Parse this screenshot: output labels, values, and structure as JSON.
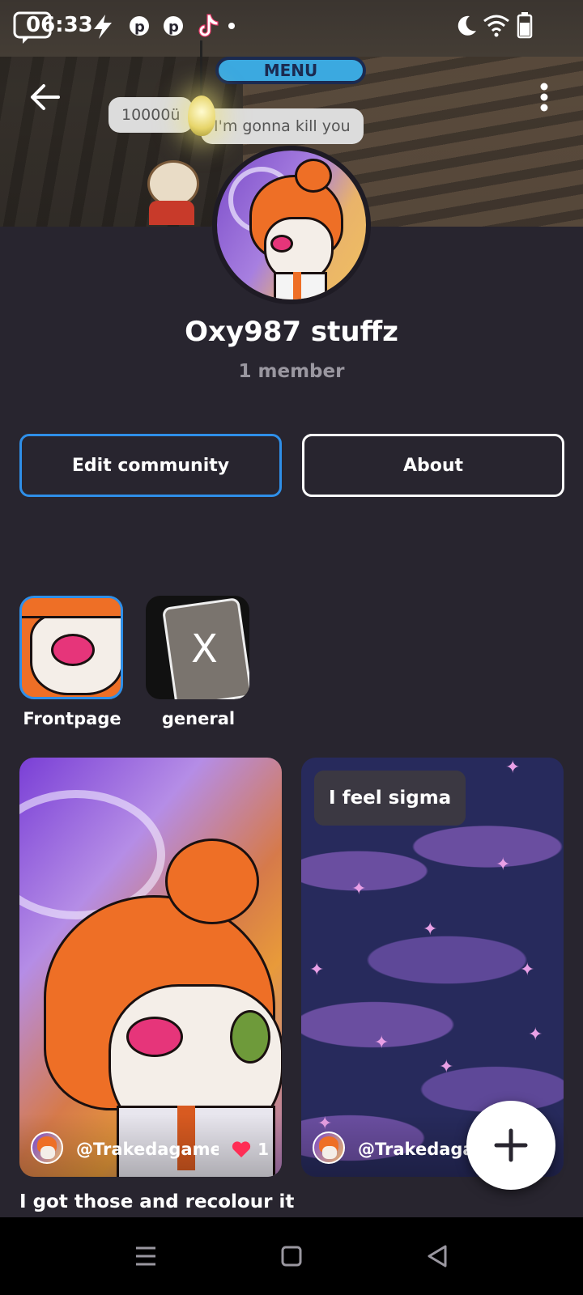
{
  "status_bar": {
    "time": "06:33",
    "icons": [
      "message-icon",
      "bolt-icon",
      "pinterest-icon",
      "pinterest-icon",
      "tiktok-icon",
      "dnd-moon-icon",
      "wifi-icon",
      "battery-icon"
    ]
  },
  "banner": {
    "menu_label": "MENU",
    "bubble_left": "10000ü",
    "bubble_right": "I'm gonna kill you"
  },
  "community": {
    "name": "Oxy987 stuffz",
    "members": "1 member"
  },
  "actions": {
    "edit_label": "Edit community",
    "about_label": "About"
  },
  "channels": [
    {
      "label": "Frontpage",
      "selected": true
    },
    {
      "label": "general",
      "selected": false
    }
  ],
  "posts": [
    {
      "author": "@Trakedagame",
      "likes": "1",
      "caption": "I got those and recolour it"
    },
    {
      "author": "@Trakedaga",
      "overlay_text": "I feel sigma"
    }
  ],
  "colors": {
    "background": "#28252f",
    "accent": "#2f8fe8",
    "heart": "#ff2d55"
  }
}
